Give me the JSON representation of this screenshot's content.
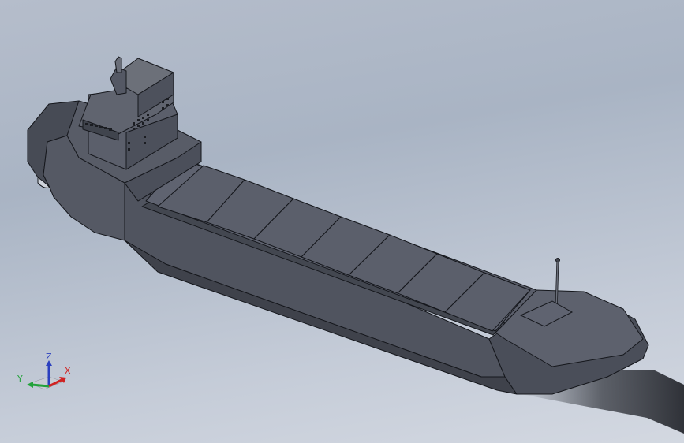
{
  "viewport": {
    "background_top": "#a9b4c4",
    "background_bottom": "#d3d8e1"
  },
  "model": {
    "object": "cargo-ship",
    "hull_color": "#4f535e",
    "deck_color": "#5a5e6a",
    "edge_color": "#15171c",
    "hatch_cover_count": 7
  },
  "triad": {
    "z_label": "Z",
    "y_label": "Y",
    "x_label": "X",
    "z_color": "#2a3fbf",
    "y_color": "#22a23a",
    "x_color": "#d02222"
  }
}
